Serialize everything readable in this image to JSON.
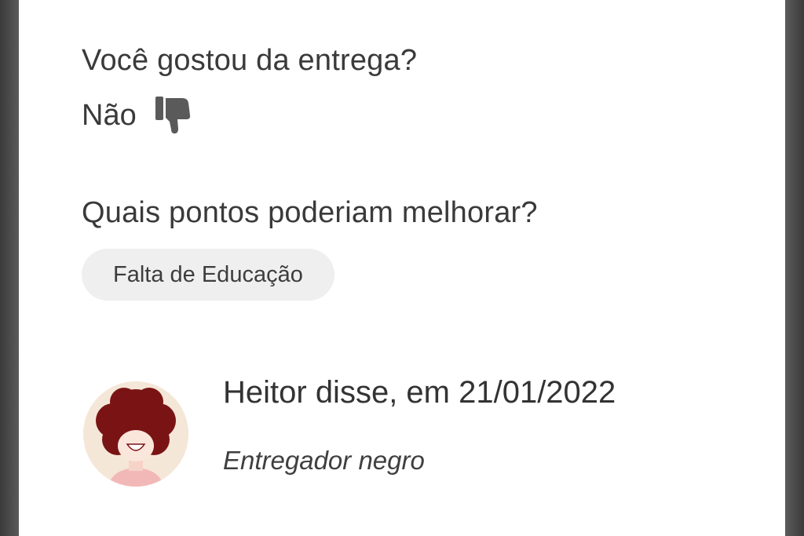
{
  "feedback": {
    "question_delivery": "Você gostou da entrega?",
    "answer_delivery": "Não",
    "answer_icon": "thumbs-down-icon",
    "question_improve": "Quais pontos poderiam melhorar?",
    "improvement_tags": [
      "Falta de Educação"
    ]
  },
  "review": {
    "avatar_icon": "avatar-curly-hair",
    "author_line": "Heitor disse, em 21/01/2022",
    "comment": "Entregador negro"
  },
  "colors": {
    "card_background": "#ffffff",
    "chip_background": "#efefef",
    "text": "#333333",
    "avatar_hair": "#7a1414",
    "avatar_background": "#f5e7d8"
  }
}
